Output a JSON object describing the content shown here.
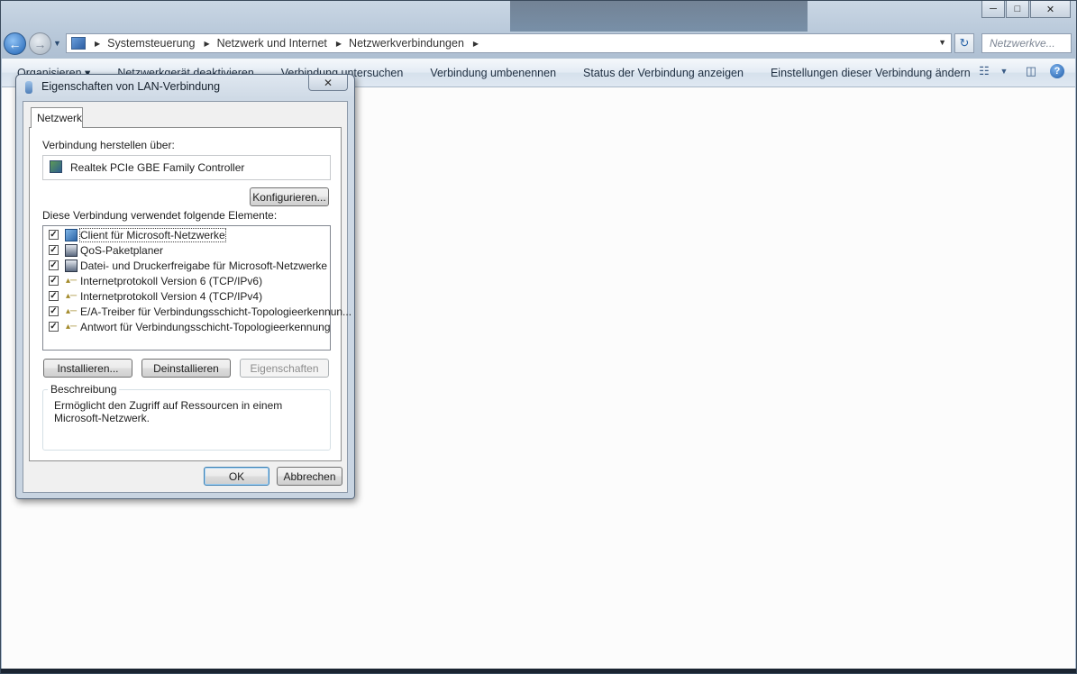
{
  "window": {
    "caption_buttons": [
      "minimize",
      "maximize",
      "close"
    ]
  },
  "navigation": {
    "breadcrumbs": [
      "Systemsteuerung",
      "Netzwerk und Internet",
      "Netzwerkverbindungen"
    ],
    "search_placeholder": "Netzwerkve..."
  },
  "toolbar": {
    "items": [
      "Organisieren ▾",
      "Netzwerkgerät deaktivieren",
      "Verbindung untersuchen",
      "Verbindung umbenennen",
      "Status der Verbindung anzeigen",
      "Einstellungen dieser Verbindung ändern"
    ]
  },
  "dialog": {
    "title": "Eigenschaften von LAN-Verbindung",
    "tab": "Netzwerk",
    "connect_using_label": "Verbindung herstellen über:",
    "adapter": "Realtek PCIe GBE Family Controller",
    "configure_button": "Konfigurieren...",
    "items_label": "Diese Verbindung verwendet folgende Elemente:",
    "items": [
      {
        "label": "Client für Microsoft-Netzwerke",
        "checked": true,
        "icon": "network-client-icon"
      },
      {
        "label": "QoS-Paketplaner",
        "checked": true,
        "icon": "service-icon"
      },
      {
        "label": "Datei- und Druckerfreigabe für Microsoft-Netzwerke",
        "checked": true,
        "icon": "service-icon"
      },
      {
        "label": "Internetprotokoll Version 6 (TCP/IPv6)",
        "checked": true,
        "icon": "protocol-icon"
      },
      {
        "label": "Internetprotokoll Version 4 (TCP/IPv4)",
        "checked": true,
        "icon": "protocol-icon"
      },
      {
        "label": "E/A-Treiber für Verbindungsschicht-Topologieerkennun...",
        "checked": true,
        "icon": "protocol-icon"
      },
      {
        "label": "Antwort für Verbindungsschicht-Topologieerkennung",
        "checked": true,
        "icon": "protocol-icon"
      }
    ],
    "install_button": "Installieren...",
    "uninstall_button": "Deinstallieren",
    "properties_button": "Eigenschaften",
    "description_legend": "Beschreibung",
    "description_text": "Ermöglicht den Zugriff auf Ressourcen in einem Microsoft-Netzwerk.",
    "ok_button": "OK",
    "cancel_button": "Abbrechen"
  }
}
